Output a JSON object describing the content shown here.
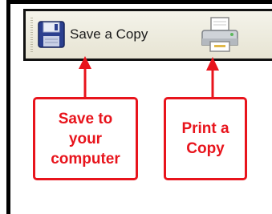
{
  "toolbar": {
    "save_label": "Save a Copy",
    "save_icon": "floppy-disk-icon",
    "print_icon": "printer-icon"
  },
  "callouts": {
    "save": "Save to\nyour\ncomputer",
    "print": "Print a\nCopy"
  },
  "colors": {
    "callout_red": "#e8141c",
    "toolbar_bg": "#efece0",
    "frame": "#000000"
  }
}
